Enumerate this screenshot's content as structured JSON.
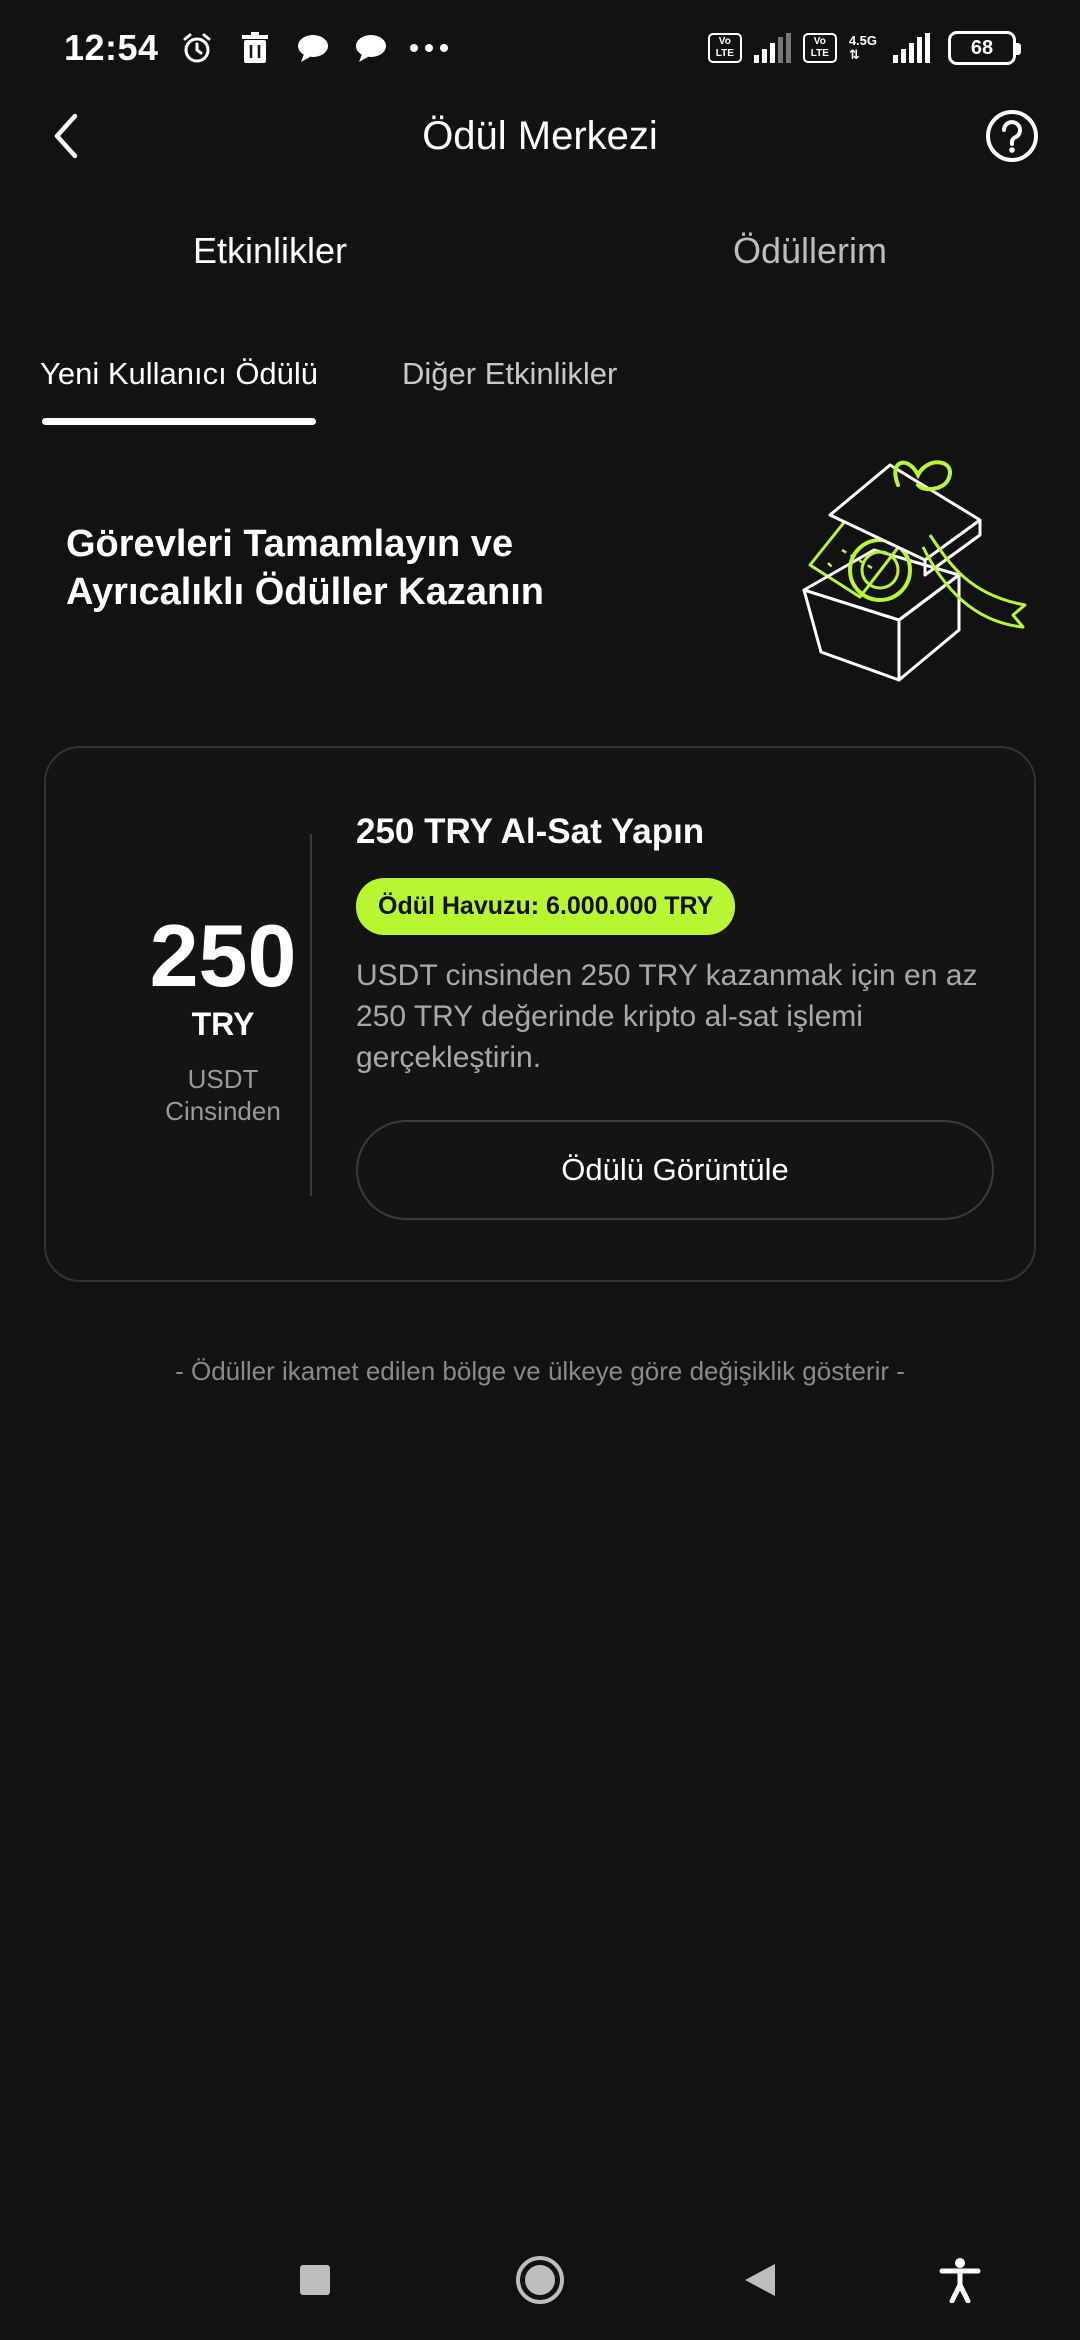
{
  "status_bar": {
    "time": "12:54",
    "network_type": "4.5G",
    "lte_label_top": "Vo",
    "lte_label_bottom": "LTE",
    "battery": "68"
  },
  "header": {
    "title": "Ödül Merkezi",
    "back_icon": "chevron-left-icon",
    "help_icon": "help-circle-icon"
  },
  "main_tabs": [
    {
      "label": "Etkinlikler",
      "active": true
    },
    {
      "label": "Ödüllerim",
      "active": false
    }
  ],
  "sub_tabs": [
    {
      "label": "Yeni Kullanıcı Ödülü",
      "active": true
    },
    {
      "label": "Diğer Etkinlikler",
      "active": false
    }
  ],
  "hero": {
    "title_line1": "Görevleri Tamamlayın ve",
    "title_line2": "Ayrıcalıklı Ödüller Kazanın"
  },
  "reward_card": {
    "amount": "250",
    "currency": "TRY",
    "sub_line1": "USDT",
    "sub_line2": "Cinsinden",
    "task_title": "250 TRY Al-Sat Yapın",
    "pool_badge": "Ödül Havuzu: 6.000.000 TRY",
    "description": "USDT cinsinden 250 TRY kazanmak için en az 250 TRY değerinde kripto al-sat işlemi gerçekleştirin.",
    "button_label": "Ödülü Görüntüle"
  },
  "footnote": "- Ödüller ikamet edilen bölge ve ülkeye göre değişiklik gösterir -",
  "colors": {
    "background": "#121212",
    "accent": "#b9f632",
    "muted_text": "#a9a9a9"
  }
}
